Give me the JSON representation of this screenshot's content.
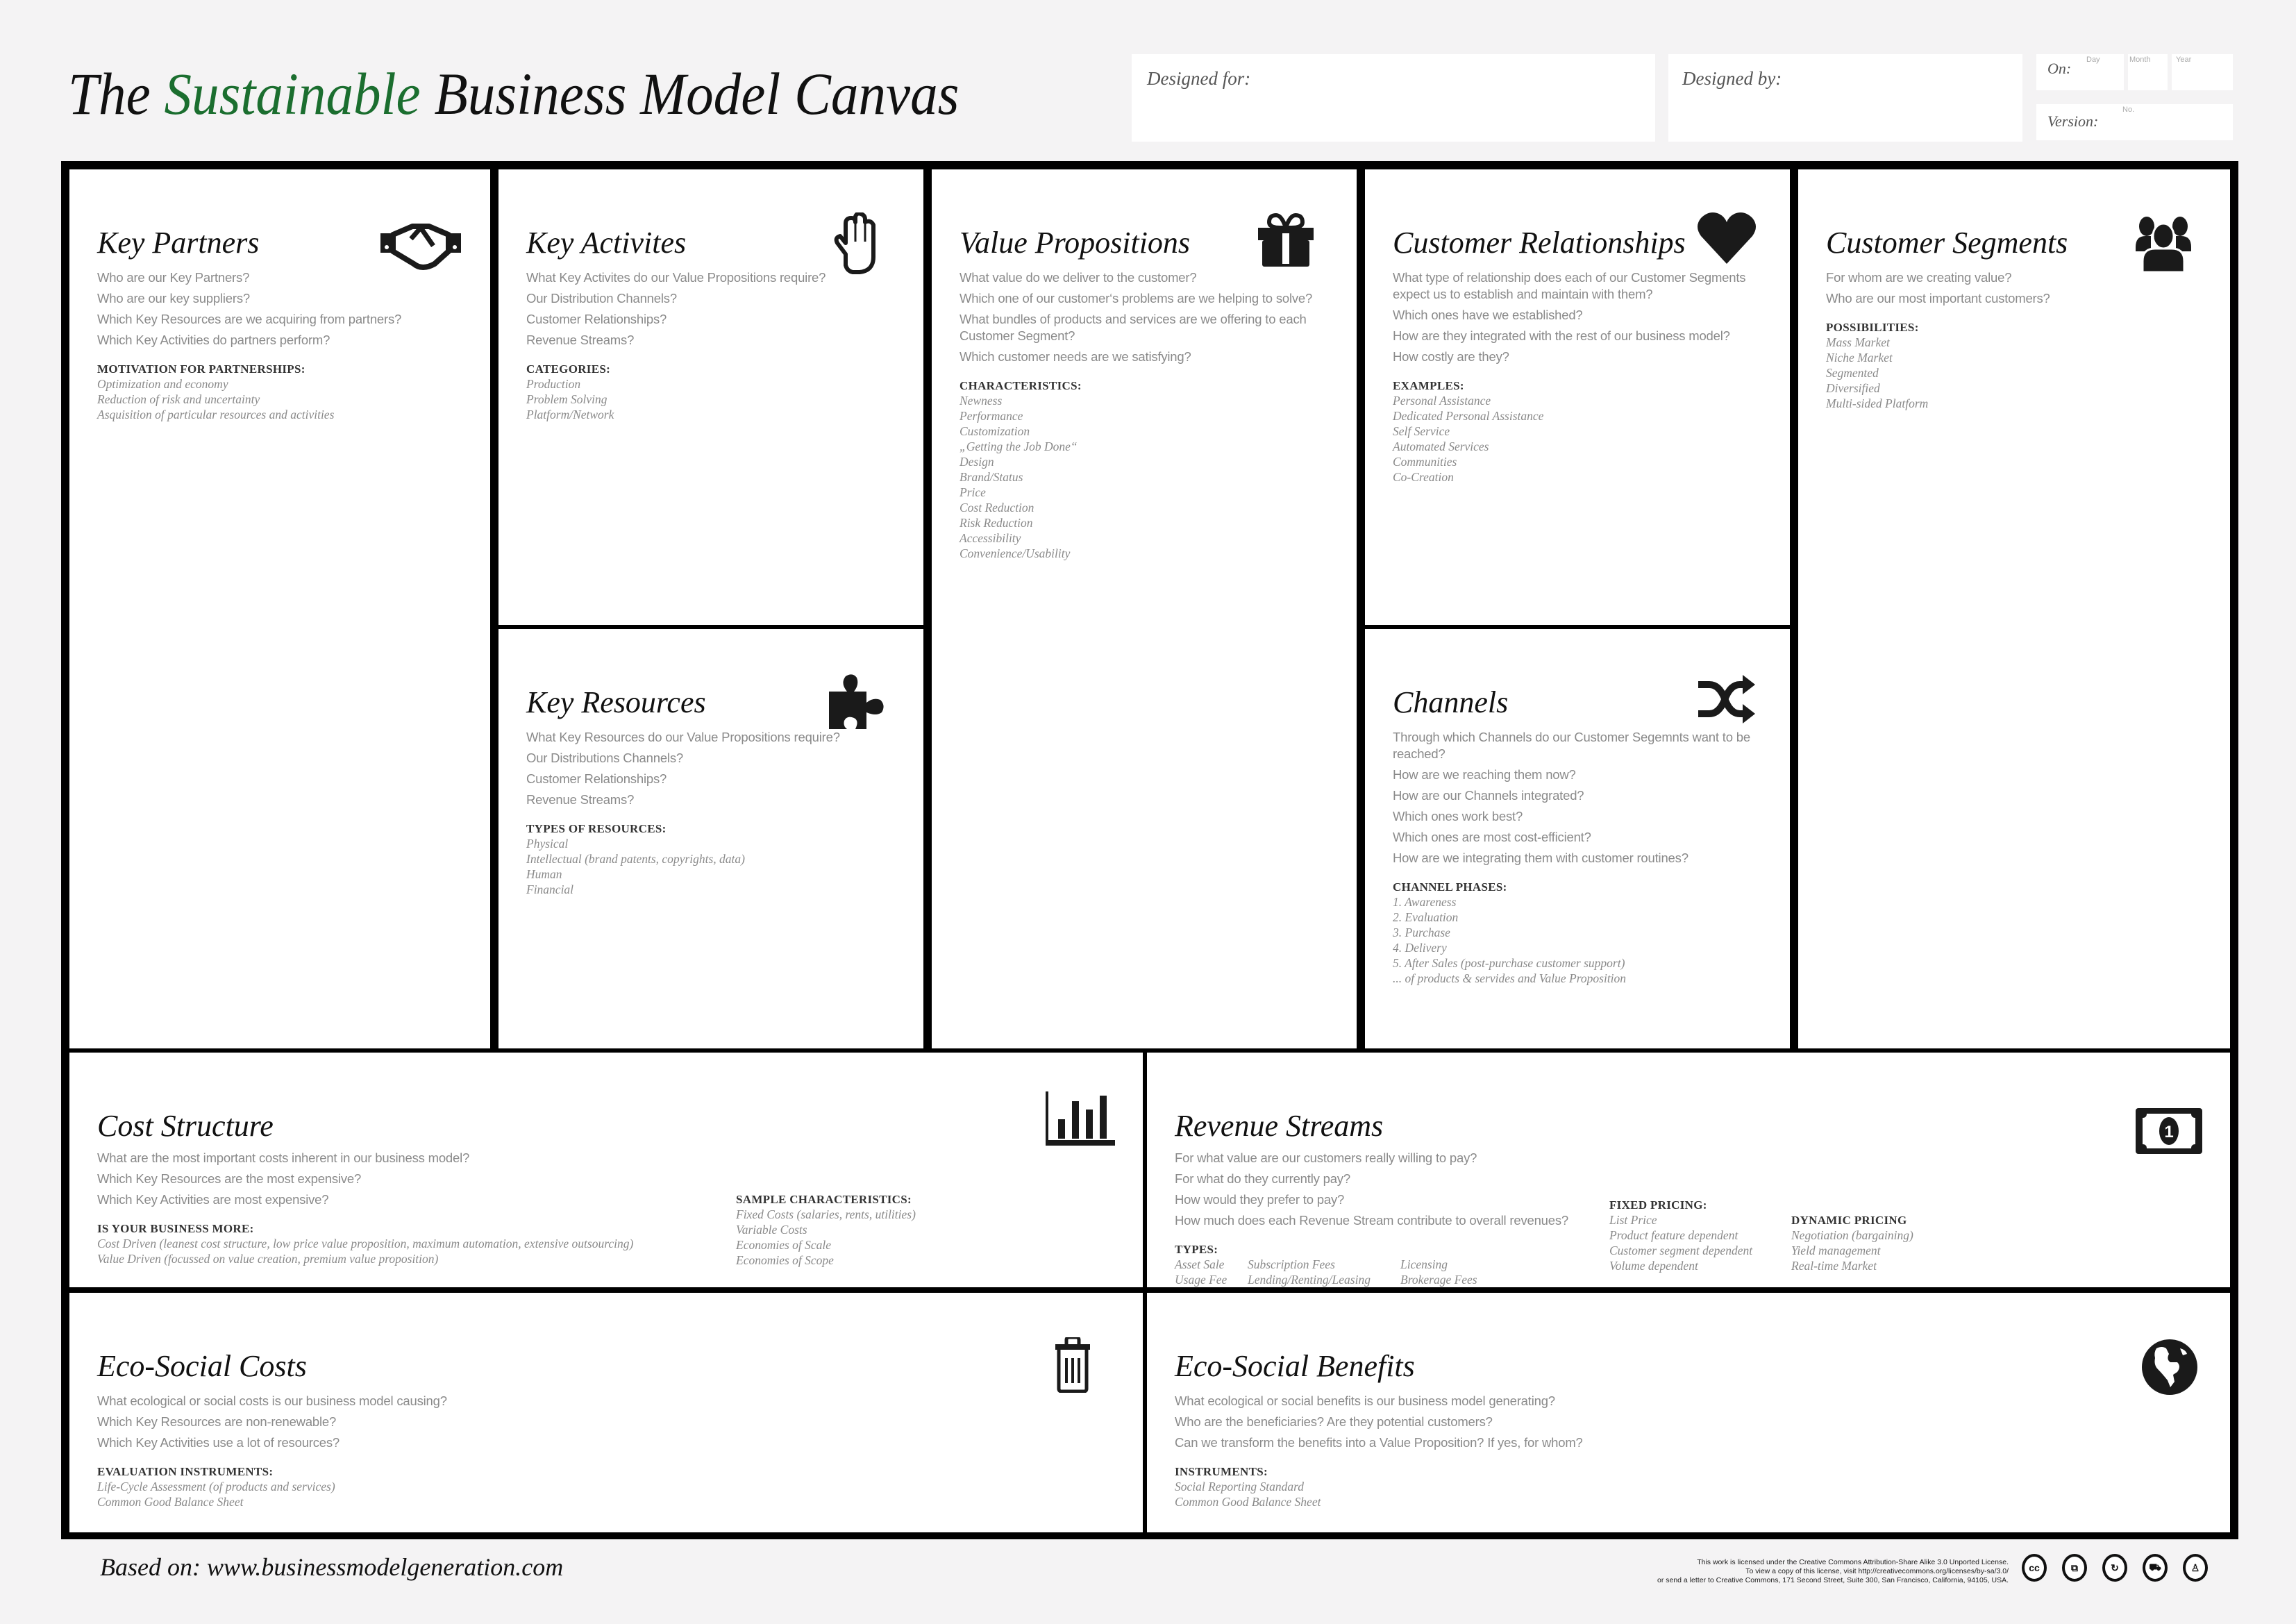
{
  "header": {
    "title_prefix": "The ",
    "title_accent": "Sustainable",
    "title_suffix": " Business Model Canvas",
    "accent_color": "#1b6e2f",
    "designed_for_label": "Designed for:",
    "designed_by_label": "Designed by:",
    "on_label": "On:",
    "day_hint": "Day",
    "month_hint": "Month",
    "year_hint": "Year",
    "version_label": "Version:",
    "version_hint": "No."
  },
  "blocks": {
    "key_partners": {
      "title": "Key Partners",
      "icon": "handshake-icon",
      "questions": [
        "Who are our Key Partners?",
        "Who are our key suppliers?",
        "Which Key Resources are we acquiring from partners?",
        "Which Key Activities do partners perform?"
      ],
      "section_label": "MOTIVATION FOR PARTNERSHIPS:",
      "items": [
        "Optimization and economy",
        "Reduction of risk and uncertainty",
        "Asquisition of particular resources and activities"
      ]
    },
    "key_activities": {
      "title": "Key Activites",
      "icon": "hand-icon",
      "questions": [
        "What Key Activites do our Value Propositions require?",
        "Our Distribution Channels?",
        "Customer Relationships?",
        "Revenue Streams?"
      ],
      "section_label": "CATEGORIES:",
      "items": [
        "Production",
        "Problem Solving",
        "Platform/Network"
      ]
    },
    "key_resources": {
      "title": "Key Resources",
      "icon": "puzzle-piece-icon",
      "questions": [
        "What Key Resources do our Value Propositions require?",
        "Our Distributions Channels?",
        "Customer Relationships?",
        "Revenue Streams?"
      ],
      "section_label": "TYPES OF RESOURCES:",
      "items": [
        "Physical",
        "Intellectual (brand patents, copyrights, data)",
        "Human",
        "Financial"
      ]
    },
    "value_propositions": {
      "title": "Value Propositions",
      "icon": "gift-icon",
      "questions": [
        "What value do we deliver to the customer?",
        "Which one of our customer‘s problems are we helping to solve?",
        "What bundles of products and services are we offering to each Customer Segment?",
        "Which customer needs are we satisfying?"
      ],
      "section_label": "CHARACTERISTICS:",
      "items": [
        "Newness",
        "Performance",
        "Customization",
        "„Getting the Job Done“",
        "Design",
        "Brand/Status",
        "Price",
        "Cost Reduction",
        "Risk Reduction",
        "Accessibility",
        "Convenience/Usability"
      ]
    },
    "customer_relationships": {
      "title": "Customer Relationships",
      "icon": "heart-icon",
      "questions": [
        "What type of relationship does each of our Customer Segments expect us to establish and maintain with them?",
        "Which ones have we established?",
        "How are they integrated with the rest of our business model?",
        "How costly are they?"
      ],
      "section_label": "EXAMPLES:",
      "items": [
        "Personal Assistance",
        "Dedicated Personal Assistance",
        "Self Service",
        "Automated Services",
        "Communities",
        "Co-Creation"
      ]
    },
    "channels": {
      "title": "Channels",
      "icon": "shuffle-icon",
      "questions": [
        "Through which Channels do our Customer Segemnts want to be reached?",
        "How are we reaching them now?",
        "How are our Channels integrated?",
        "Which ones work best?",
        "Which ones are most cost-efficient?",
        "How are we integrating them with customer routines?"
      ],
      "section_label": "CHANNEL PHASES:",
      "items": [
        "1. Awareness",
        "2. Evaluation",
        "3. Purchase",
        "4. Delivery",
        "5. After Sales (post-purchase customer support)",
        "... of  products & servides and Value Proposition"
      ]
    },
    "customer_segments": {
      "title": "Customer Segments",
      "icon": "users-icon",
      "questions": [
        "For whom are we creating value?",
        "Who are our most important customers?"
      ],
      "section_label": "POSSIBILITIES:",
      "items": [
        "Mass Market",
        "Niche Market",
        "Segmented",
        "Diversified",
        "Multi-sided Platform"
      ]
    },
    "cost_structure": {
      "title": "Cost Structure",
      "icon": "bar-chart-icon",
      "questions": [
        "What are the most important costs inherent in our business model?",
        "Which Key Resources are the most expensive?",
        "Which Key Activities are most expensive?"
      ],
      "section_label": "IS YOUR BUSINESS MORE:",
      "items": [
        "Cost Driven (leanest cost structure, low price value proposition, maximum automation, extensive outsourcing)",
        "Value Driven (focussed on value creation, premium value proposition)"
      ],
      "section2_label": "SAMPLE CHARACTERISTICS:",
      "items2": [
        "Fixed Costs (salaries, rents, utilities)",
        "Variable Costs",
        "Economies of Scale",
        "Economies of Scope"
      ]
    },
    "revenue_streams": {
      "title": "Revenue Streams",
      "icon": "banknote-icon",
      "questions": [
        "For what value are our customers really willing to pay?",
        "For what do they currently pay?",
        "How would they prefer to pay?",
        "How much does each Revenue Stream contribute to overall revenues?"
      ],
      "types_label": "TYPES:",
      "types": [
        [
          "Asset Sale",
          "Subscription Fees",
          "Licensing"
        ],
        [
          "Usage Fee",
          "Lending/Renting/Leasing",
          "Brokerage Fees"
        ]
      ],
      "fixed_label": "FIXED PRICING:",
      "fixed_items": [
        "List Price",
        "Product feature dependent",
        "Customer segment dependent",
        "Volume dependent"
      ],
      "dynamic_label": "DYNAMIC PRICING",
      "dynamic_items": [
        "Negotiation (bargaining)",
        "Yield management",
        "Real-time Market"
      ]
    },
    "eco_social_costs": {
      "title": "Eco-Social Costs",
      "icon": "trash-icon",
      "questions": [
        "What ecological or social costs is our business model causing?",
        "Which Key Resources are non-renewable?",
        "Which Key Activities use a lot of resources?"
      ],
      "section_label": "EVALUATION INSTRUMENTS:",
      "items": [
        "Life-Cycle Assessment (of products and services)",
        "Common Good Balance Sheet"
      ]
    },
    "eco_social_benefits": {
      "title": "Eco-Social Benefits",
      "icon": "globe-icon",
      "questions": [
        "What ecological or social benefits is our business model generating?",
        "Who are the beneficiaries? Are they potential customers?",
        "Can we transform the benefits into a Value Proposition? If yes, for whom?"
      ],
      "section_label": "INSTRUMENTS:",
      "items": [
        "Social Reporting Standard",
        "Common Good Balance Sheet"
      ]
    }
  },
  "footer": {
    "based_on": "Based on: www.businessmodelgeneration.com",
    "license_lines": [
      "This work is licensed under the Creative Commons Attribution-Share Alike 3.0 Unported License.",
      "To view a copy of this license, visit http://creativecommons.org/licenses/by-sa/3.0/",
      "or send a letter to Creative Commons, 171 Second Street, Suite 300, San Francisco, California, 94105, USA."
    ],
    "cc_icons": [
      {
        "name": "cc-icon",
        "glyph": "cc"
      },
      {
        "name": "copy-icon",
        "glyph": "⧉"
      },
      {
        "name": "share-alike-icon",
        "glyph": "↻"
      },
      {
        "name": "commercial-icon",
        "glyph": "⛟"
      },
      {
        "name": "attribution-icon",
        "glyph": "♙"
      }
    ]
  }
}
